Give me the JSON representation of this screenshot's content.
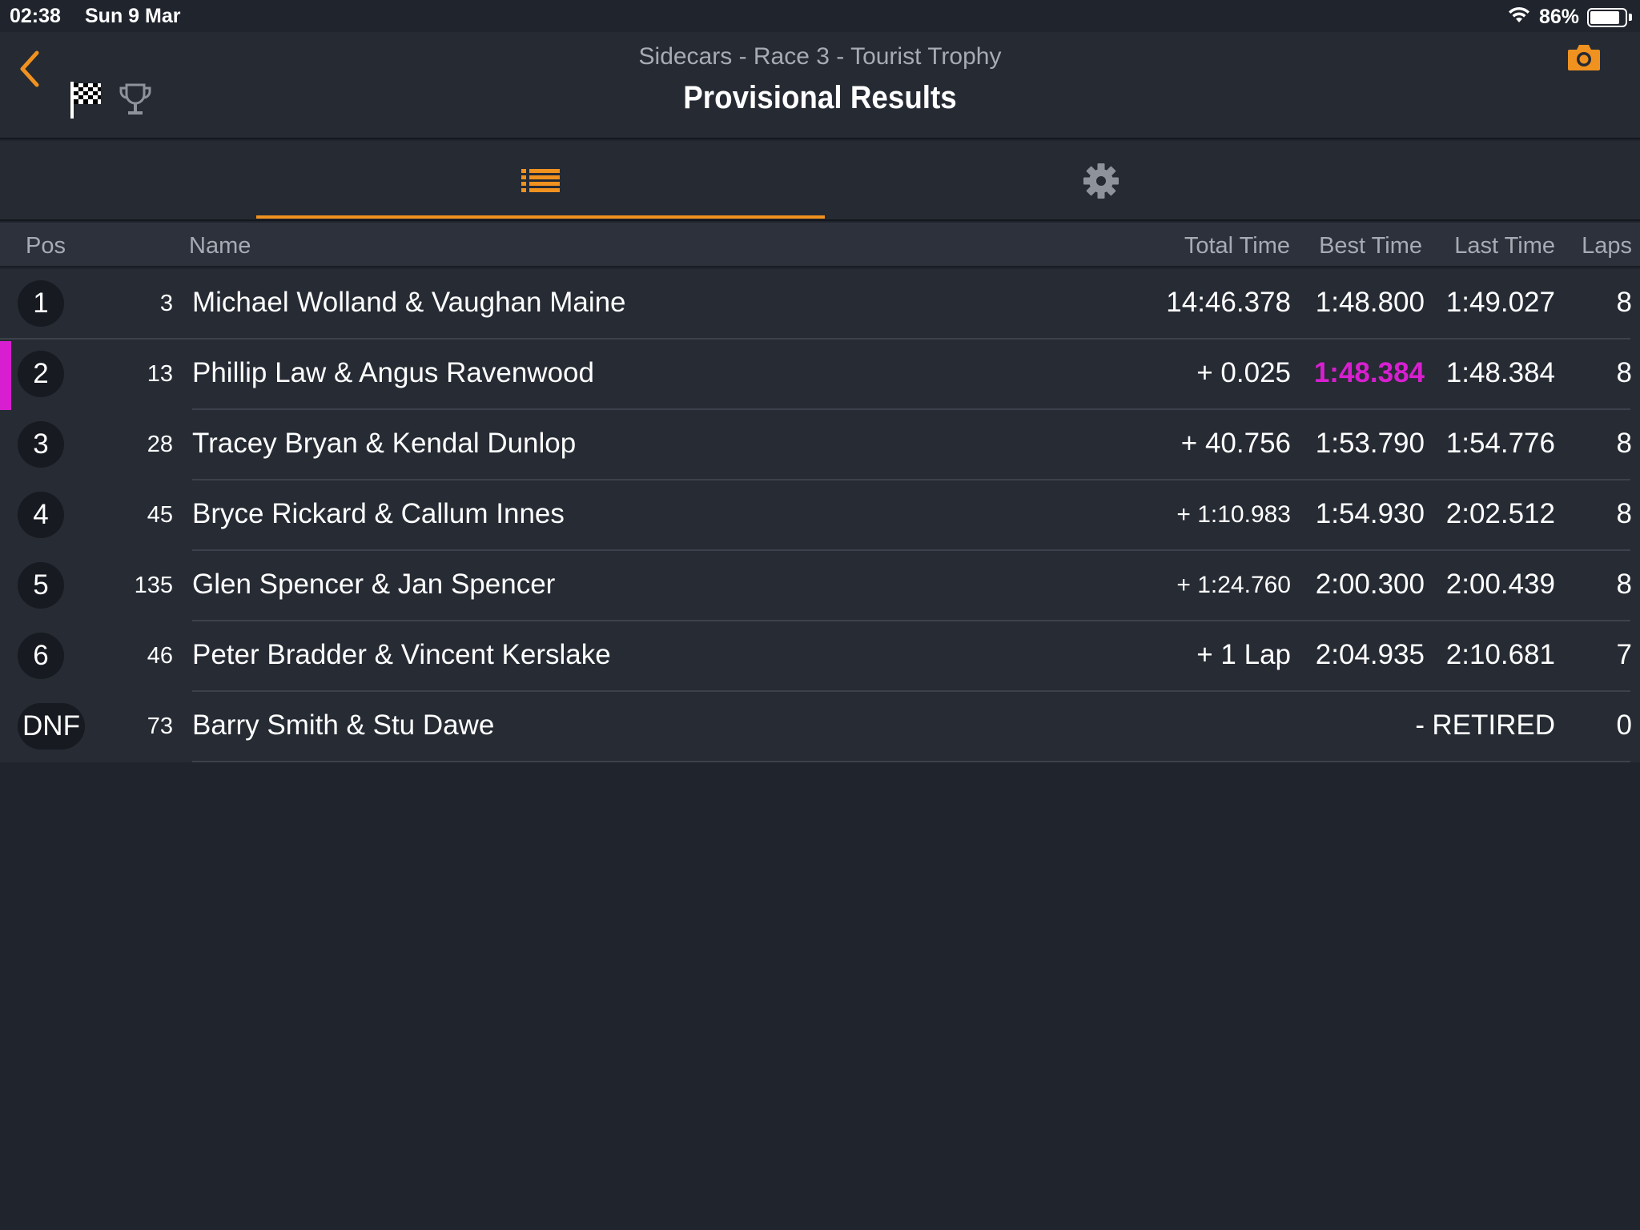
{
  "status_bar": {
    "time": "02:38",
    "date": "Sun 9 Mar",
    "battery": "86%",
    "battery_level": 0.86
  },
  "header": {
    "subtitle": "Sidecars - Race 3 - Tourist Trophy",
    "title": "Provisional Results"
  },
  "columns": {
    "pos": "Pos",
    "name": "Name",
    "total_time": "Total Time",
    "best_time": "Best Time",
    "last_time": "Last Time",
    "laps": "Laps"
  },
  "rows": [
    {
      "pos": "1",
      "number": "3",
      "name": "Michael Wolland & Vaughan Maine",
      "total": "14:46.378",
      "best": "1:48.800",
      "last": "1:49.027",
      "laps": "8"
    },
    {
      "pos": "2",
      "number": "13",
      "name": "Phillip Law & Angus Ravenwood",
      "total": "+ 0.025",
      "best": "1:48.384",
      "last": "1:48.384",
      "laps": "8"
    },
    {
      "pos": "3",
      "number": "28",
      "name": "Tracey Bryan & Kendal Dunlop",
      "total": "+ 40.756",
      "best": "1:53.790",
      "last": "1:54.776",
      "laps": "8"
    },
    {
      "pos": "4",
      "number": "45",
      "name": "Bryce Rickard & Callum Innes",
      "total": "+ 1:10.983",
      "best": "1:54.930",
      "last": "2:02.512",
      "laps": "8"
    },
    {
      "pos": "5",
      "number": "135",
      "name": "Glen Spencer & Jan Spencer",
      "total": "+ 1:24.760",
      "best": "2:00.300",
      "last": "2:00.439",
      "laps": "8"
    },
    {
      "pos": "6",
      "number": "46",
      "name": "Peter Bradder & Vincent Kerslake",
      "total": "+ 1 Lap",
      "best": "2:04.935",
      "last": "2:10.681",
      "laps": "7"
    },
    {
      "pos": "DNF",
      "number": "73",
      "name": "Barry Smith & Stu Dawe",
      "total": "",
      "best": "-",
      "last": "RETIRED",
      "laps": "0"
    }
  ],
  "colors": {
    "accent": "#f0921f",
    "fastest_lap": "#d81fd0",
    "background": "#20242d"
  },
  "icons": {
    "back": "chevron-left-icon",
    "flag": "checkered-flag-icon",
    "trophy": "trophy-icon",
    "camera": "camera-icon",
    "list_tab": "list-icon",
    "settings_tab": "gear-icon"
  }
}
